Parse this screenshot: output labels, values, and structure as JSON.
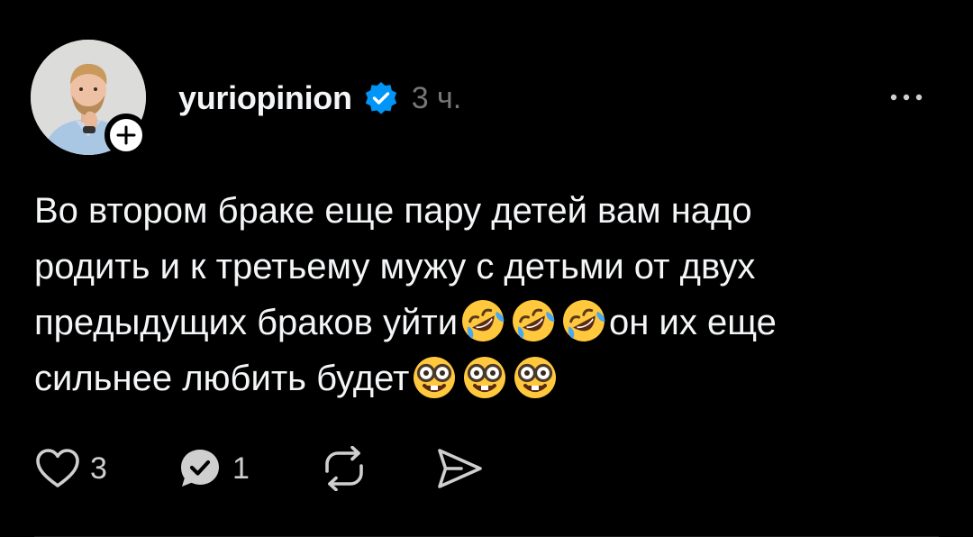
{
  "post": {
    "author": {
      "username": "yuriopinion",
      "verified": true
    },
    "time_ago": "3 ч.",
    "text_lines": [
      "Во втором браке еще пару детей вам надо",
      "родить и к третьему мужу с детьми от двух",
      "предыдущих браков уйти",
      "он их еще",
      "сильнее любить будет"
    ],
    "emojis": {
      "line3": [
        "rolling-on-floor-laughing",
        "rolling-on-floor-laughing",
        "rolling-on-floor-laughing"
      ],
      "line4": [
        "nerd-face",
        "nerd-face",
        "nerd-face"
      ]
    },
    "stats": {
      "likes": "3",
      "replies": "1"
    }
  },
  "colors": {
    "background": "#000000",
    "text": "#f3f5f7",
    "muted": "#777777",
    "verified_blue": "#0095f6"
  },
  "icons": {
    "like": "heart-icon",
    "reply": "reply-bubble-icon",
    "repost": "repost-icon",
    "share": "send-icon",
    "more": "more-icon",
    "follow": "plus-icon",
    "verified": "verified-badge-icon"
  }
}
